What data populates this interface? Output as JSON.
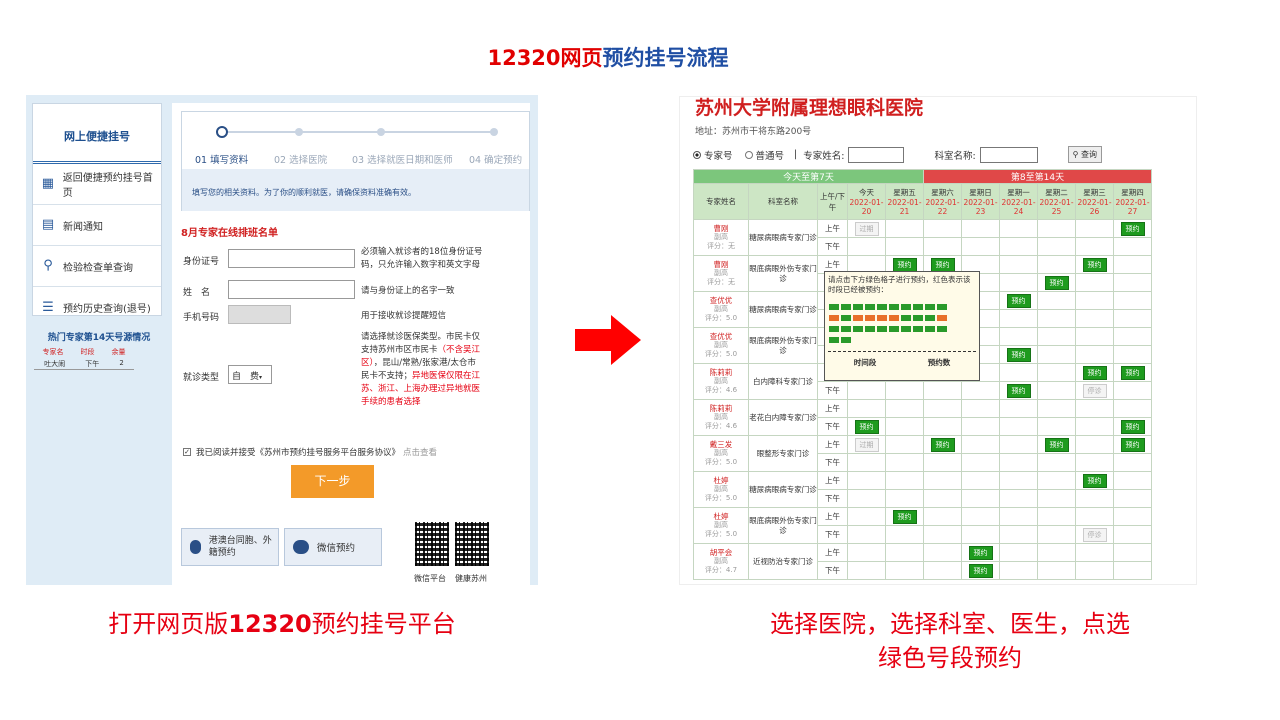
{
  "slide": {
    "title_num": "12320",
    "title_red": "网页",
    "title_blue": "预约挂号流程",
    "caption_left": "打开网页版",
    "caption_left_num": "12320",
    "caption_left_tail": "预约挂号平台",
    "caption_right_1": "选择医院，选择科室、医生，点选",
    "caption_right_2": "绿色号段预约"
  },
  "left": {
    "sidebar": {
      "title": "网上便捷挂号",
      "items": [
        "返回便捷预约挂号首页",
        "新闻通知",
        "检验检查单查询",
        "预约历史查询(退号)"
      ]
    },
    "hot": {
      "title": "热门专家第14天号源情况",
      "cols": [
        "专家名",
        "时段",
        "余量"
      ],
      "row": [
        "吐大闹",
        "下午",
        "2"
      ]
    },
    "steps": [
      "01 填写资料",
      "02 选择医院",
      "03 选择就医日期和医师",
      "04 确定预约"
    ],
    "steps_note": "填写您的相关资料。为了你的顺利就医，请确保资料准确有效。",
    "roster_title": "8月专家在线排班名单",
    "form": {
      "id_label": "身份证号",
      "id_note": "必须输入就诊者的18位身份证号码，只允许输入数字和英文字母",
      "name_label": "姓　名",
      "name_note": "请与身份证上的名字一致",
      "phone_label": "手机号码",
      "phone_note": "用于接收就诊提醒短信",
      "type_label": "就诊类型",
      "type_value": "自　费",
      "type_note_1": "请选择就诊医保类型。市民卡仅支持苏州市区市民卡",
      "type_note_red1": "（不含吴江区）",
      "type_note_2": "，昆山/常熟/张家港/太仓市民卡不支持；",
      "type_note_red2": "异地医保仅限在江苏、浙江、上海办理过异地就医手续的患者选择",
      "agree": "我已阅读并接受《苏州市预约挂号服务平台服务协议》",
      "agree_link": "点击查看"
    },
    "next_btn": "下一步",
    "cards": [
      "港澳台同胞、外籍预约",
      "微信预约"
    ],
    "qr_labels": [
      "微信平台",
      "健康苏州"
    ]
  },
  "right": {
    "hospital": "苏州大学附属理想眼科医院",
    "address": "地址：苏州市干将东路200号",
    "radio_expert": "专家号",
    "radio_normal": "普通号",
    "expert_name_label": "专家姓名:",
    "dept_label": "科室名称:",
    "query_btn": "查询",
    "band1": "今天至第7天",
    "band2": "第8至第14天",
    "headers": [
      "专家姓名",
      "科室名称",
      "上午/下午"
    ],
    "days": [
      [
        "今天",
        "2022-01-20"
      ],
      [
        "星期五",
        "2022-01-21"
      ],
      [
        "星期六",
        "2022-01-22"
      ],
      [
        "星期日",
        "2022-01-23"
      ],
      [
        "星期一",
        "2022-01-24"
      ],
      [
        "星期二",
        "2022-01-25"
      ],
      [
        "星期三",
        "2022-01-26"
      ],
      [
        "星期四",
        "2022-01-27"
      ]
    ],
    "am": "上午",
    "pm": "下午",
    "book": "预约",
    "expired": "过期",
    "stop": "停诊",
    "doctors": [
      {
        "name": "曹刚",
        "title": "副高",
        "score": "评分：无",
        "dept": "糖尿病眼病专家门诊",
        "am": [
          "过期",
          "",
          "",
          "",
          "",
          "",
          "",
          "预约"
        ],
        "pm": [
          "",
          "",
          "",
          "",
          "",
          "",
          "",
          ""
        ]
      },
      {
        "name": "曹刚",
        "title": "副高",
        "score": "评分：无",
        "dept": "眼底病眼外伤专家门诊",
        "am": [
          "",
          "预约",
          "预约",
          "",
          "",
          "",
          "预约",
          ""
        ],
        "pm": [
          "",
          "",
          "",
          "",
          "",
          "预约",
          "",
          ""
        ]
      },
      {
        "name": "查优优",
        "title": "副高",
        "score": "评分：5.0",
        "dept": "糖尿病眼病专家门诊",
        "am": [
          "",
          "",
          "",
          "",
          "预约",
          "",
          "",
          ""
        ],
        "pm": [
          "",
          "",
          "",
          "",
          "",
          "",
          "",
          ""
        ]
      },
      {
        "name": "查优优",
        "title": "副高",
        "score": "评分：5.0",
        "dept": "眼底病眼外伤专家门诊",
        "am": [
          "",
          "",
          "",
          "",
          "",
          "",
          "",
          ""
        ],
        "pm": [
          "",
          "",
          "",
          "",
          "预约",
          "",
          "",
          ""
        ]
      },
      {
        "name": "陈莉莉",
        "title": "副高",
        "score": "评分：4.6",
        "dept": "白内障科专家门诊",
        "am": [
          "",
          "",
          "",
          "",
          "",
          "",
          "预约",
          "预约"
        ],
        "pm": [
          "",
          "",
          "",
          "",
          "预约",
          "",
          "停诊",
          ""
        ]
      },
      {
        "name": "陈莉莉",
        "title": "副高",
        "score": "评分：4.6",
        "dept": "老花白内障专家门诊",
        "am": [
          "",
          "",
          "",
          "",
          "",
          "",
          "",
          ""
        ],
        "pm": [
          "预约",
          "",
          "",
          "",
          "",
          "",
          "",
          "预约"
        ]
      },
      {
        "name": "戴三发",
        "title": "副高",
        "score": "评分：5.0",
        "dept": "眼整形专家门诊",
        "am": [
          "过期",
          "",
          "预约",
          "",
          "",
          "预约",
          "",
          "预约"
        ],
        "pm": [
          "",
          "",
          "",
          "",
          "",
          "",
          "",
          ""
        ]
      },
      {
        "name": "杜婷",
        "title": "副高",
        "score": "评分：5.0",
        "dept": "糖尿病眼病专家门诊",
        "am": [
          "",
          "",
          "",
          "",
          "",
          "",
          "预约",
          ""
        ],
        "pm": [
          "",
          "",
          "",
          "",
          "",
          "",
          "",
          ""
        ]
      },
      {
        "name": "杜婷",
        "title": "副高",
        "score": "评分：5.0",
        "dept": "眼底病眼外伤专家门诊",
        "am": [
          "",
          "预约",
          "",
          "",
          "",
          "",
          "",
          ""
        ],
        "pm": [
          "",
          "",
          "",
          "",
          "",
          "",
          "停诊",
          ""
        ]
      },
      {
        "name": "胡平会",
        "title": "副高",
        "score": "评分：4.7",
        "dept": "近视防治专家门诊",
        "am": [
          "",
          "",
          "",
          "预约",
          "",
          "",
          "",
          ""
        ],
        "pm": [
          "",
          "",
          "",
          "预约",
          "",
          "",
          "",
          ""
        ]
      }
    ],
    "popup_text": "请点击下方绿色格子进行预约，红色表示该时段已经被预约：",
    "popup_col1": "时间段",
    "popup_col2": "预约数"
  },
  "colors": {
    "accent_green": "#1e9b1e",
    "header_green": "#6fbf6f",
    "band_red": "#e04848",
    "brand_red": "#e60012",
    "brand_blue": "#1f4ea3"
  }
}
